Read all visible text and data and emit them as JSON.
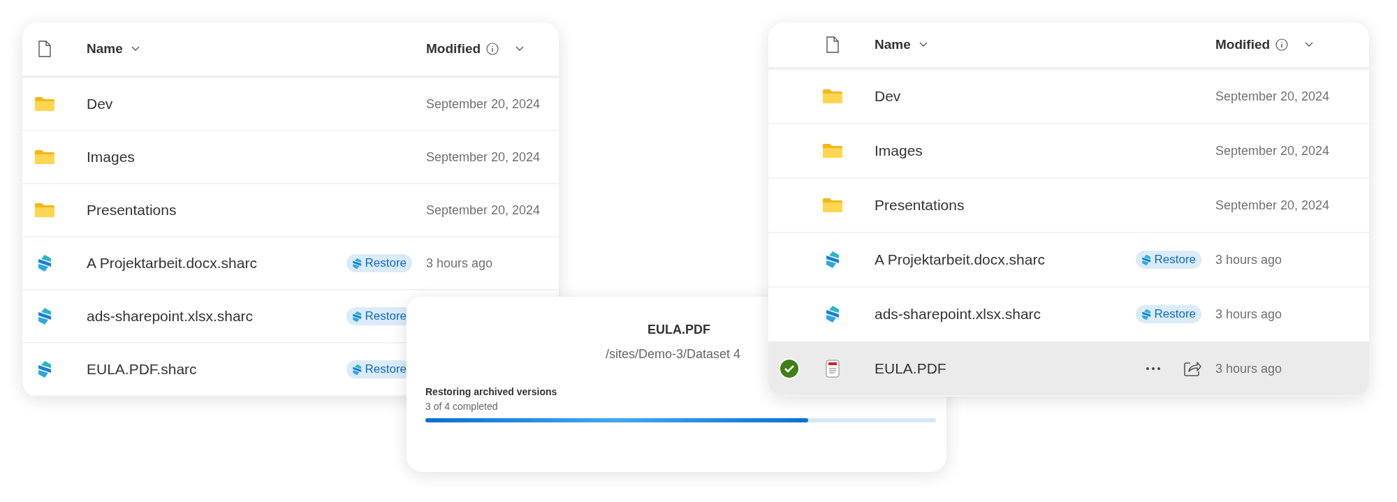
{
  "left_list": {
    "columns": {
      "name": "Name",
      "modified": "Modified"
    },
    "rows": [
      {
        "kind": "folder",
        "name": "Dev",
        "modified": "September 20, 2024"
      },
      {
        "kind": "folder",
        "name": "Images",
        "modified": "September 20, 2024"
      },
      {
        "kind": "folder",
        "name": "Presentations",
        "modified": "September 20, 2024"
      },
      {
        "kind": "sharc",
        "name": "A Projektarbeit.docx.sharc",
        "action": "Restore",
        "modified": "3 hours ago"
      },
      {
        "kind": "sharc",
        "name": "ads-sharepoint.xlsx.sharc",
        "action": "Restore"
      },
      {
        "kind": "sharc",
        "name": "EULA.PDF.sharc",
        "action": "Restore"
      }
    ]
  },
  "restore_dialog": {
    "title": "EULA.PDF",
    "path": "/sites/Demo-3/Dataset 4",
    "status": "Restoring archived versions",
    "count": "3 of 4 completed",
    "level": 0.75
  },
  "right_list": {
    "columns": {
      "name": "Name",
      "modified": "Modified"
    },
    "rows": [
      {
        "kind": "folder",
        "name": "Dev",
        "modified": "September 20, 2024",
        "selected": false
      },
      {
        "kind": "folder",
        "name": "Images",
        "modified": "September 20, 2024",
        "selected": false
      },
      {
        "kind": "folder",
        "name": "Presentations",
        "modified": "September 20, 2024",
        "selected": false
      },
      {
        "kind": "sharc",
        "name": "A Projektarbeit.docx.sharc",
        "action": "Restore",
        "modified": "3 hours ago",
        "selected": false
      },
      {
        "kind": "sharc",
        "name": "ads-sharepoint.xlsx.sharc",
        "action": "Restore",
        "modified": "3 hours ago",
        "selected": false
      },
      {
        "kind": "pdf",
        "name": "EULA.PDF",
        "modified": "3 hours ago",
        "selected": true
      }
    ]
  }
}
